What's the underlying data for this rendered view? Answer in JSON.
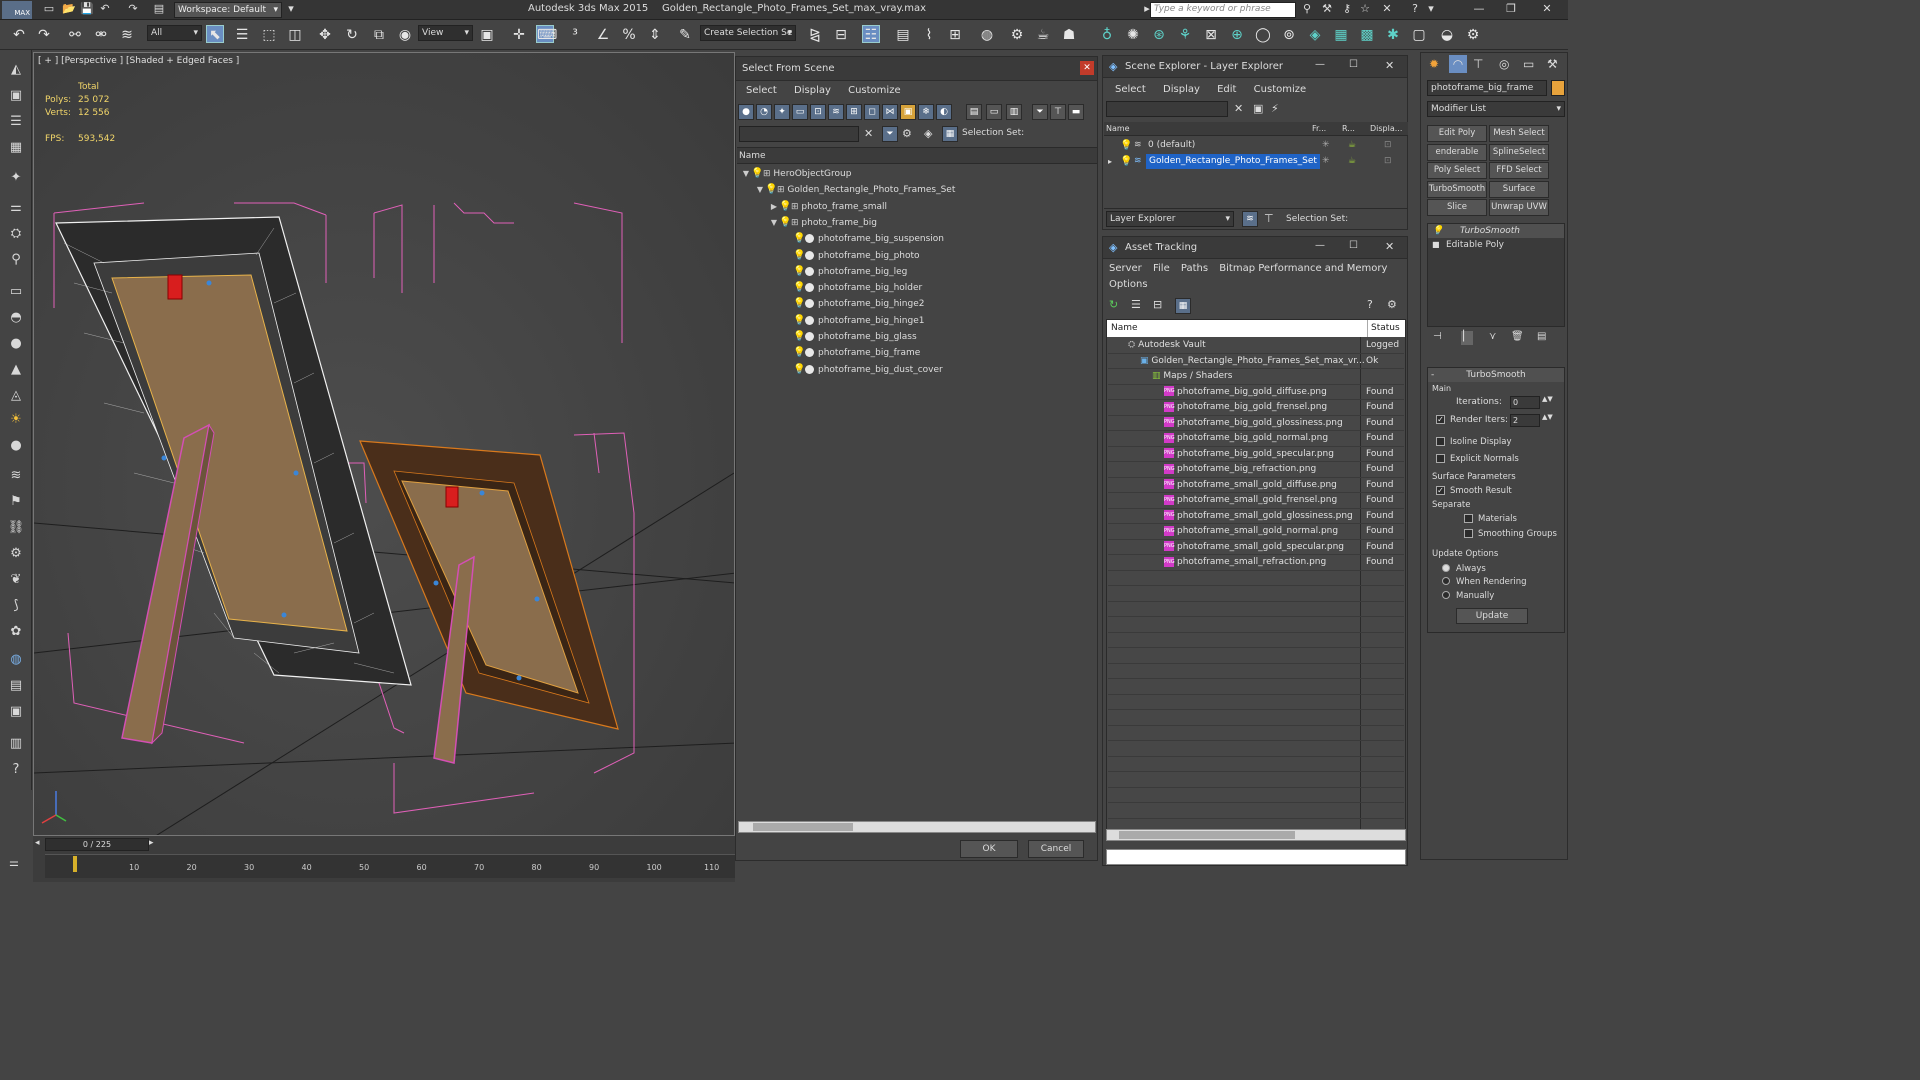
{
  "app": {
    "logo": "MAX",
    "workspace": "Workspace: Default",
    "title_app": "Autodesk 3ds Max  2015",
    "title_file": "Golden_Rectangle_Photo_Frames_Set_max_vray.max",
    "search_placeholder": "Type a keyword or phrase"
  },
  "toolbar": {
    "filter": "All",
    "view": "View",
    "selection_set": "Create Selection Se"
  },
  "viewport": {
    "label": "[ + ] [Perspective ] [Shaded + Edged Faces ]",
    "stats_header": "Total",
    "polys_label": "Polys:",
    "polys_value": "25 072",
    "verts_label": "Verts:",
    "verts_value": "12 556",
    "fps_label": "FPS:",
    "fps_value": "593,542"
  },
  "timeline": {
    "frame": "0 / 225",
    "ticks": [
      "10",
      "20",
      "30",
      "40",
      "50",
      "60",
      "70",
      "80",
      "90",
      "100",
      "110"
    ]
  },
  "select_from_scene": {
    "title": "Select From Scene",
    "menu": [
      "Select",
      "Display",
      "Customize"
    ],
    "selection_set_label": "Selection Set:",
    "column_name": "Name",
    "ok": "OK",
    "cancel": "Cancel",
    "tree": [
      {
        "name": "HeroObjectGroup",
        "level": 0,
        "expand": "down",
        "type": "group"
      },
      {
        "name": "Golden_Rectangle_Photo_Frames_Set",
        "level": 1,
        "expand": "down",
        "type": "group"
      },
      {
        "name": "photo_frame_small",
        "level": 2,
        "expand": "right",
        "type": "group"
      },
      {
        "name": "photo_frame_big",
        "level": 2,
        "expand": "down",
        "type": "group"
      },
      {
        "name": "photoframe_big_suspension",
        "level": 3,
        "expand": "",
        "type": "object"
      },
      {
        "name": "photoframe_big_photo",
        "level": 3,
        "expand": "",
        "type": "object"
      },
      {
        "name": "photoframe_big_leg",
        "level": 3,
        "expand": "",
        "type": "object"
      },
      {
        "name": "photoframe_big_holder",
        "level": 3,
        "expand": "",
        "type": "object"
      },
      {
        "name": "photoframe_big_hinge2",
        "level": 3,
        "expand": "",
        "type": "object"
      },
      {
        "name": "photoframe_big_hinge1",
        "level": 3,
        "expand": "",
        "type": "object"
      },
      {
        "name": "photoframe_big_glass",
        "level": 3,
        "expand": "",
        "type": "object"
      },
      {
        "name": "photoframe_big_frame",
        "level": 3,
        "expand": "",
        "type": "object"
      },
      {
        "name": "photoframe_big_dust_cover",
        "level": 3,
        "expand": "",
        "type": "object"
      }
    ]
  },
  "scene_explorer": {
    "title": "Scene Explorer - Layer Explorer",
    "menu": [
      "Select",
      "Display",
      "Edit",
      "Customize"
    ],
    "columns": [
      "Name",
      "Fr...",
      "R...",
      "Displa..."
    ],
    "layers": [
      {
        "name": "0 (default)",
        "selected": false
      },
      {
        "name": "Golden_Rectangle_Photo_Frames_Set",
        "selected": true
      }
    ],
    "footer_combo": "Layer Explorer",
    "selection_set_label": "Selection Set:"
  },
  "asset_tracking": {
    "title": "Asset Tracking",
    "menu": [
      "Server",
      "File",
      "Paths",
      "Bitmap Performance and Memory"
    ],
    "menu2": "Options",
    "col_name": "Name",
    "col_status": "Status",
    "rows": [
      {
        "name": "Autodesk Vault",
        "status": "Logged",
        "indent": 1,
        "icon": "vault"
      },
      {
        "name": "Golden_Rectangle_Photo_Frames_Set_max_vr...",
        "status": "Ok",
        "indent": 2,
        "icon": "max"
      },
      {
        "name": "Maps / Shaders",
        "status": "",
        "indent": 3,
        "icon": "maps"
      },
      {
        "name": "photoframe_big_gold_diffuse.png",
        "status": "Found",
        "indent": 4,
        "icon": "png"
      },
      {
        "name": "photoframe_big_gold_frensel.png",
        "status": "Found",
        "indent": 4,
        "icon": "png"
      },
      {
        "name": "photoframe_big_gold_glossiness.png",
        "status": "Found",
        "indent": 4,
        "icon": "png"
      },
      {
        "name": "photoframe_big_gold_normal.png",
        "status": "Found",
        "indent": 4,
        "icon": "png"
      },
      {
        "name": "photoframe_big_gold_specular.png",
        "status": "Found",
        "indent": 4,
        "icon": "png"
      },
      {
        "name": "photoframe_big_refraction.png",
        "status": "Found",
        "indent": 4,
        "icon": "png"
      },
      {
        "name": "photoframe_small_gold_diffuse.png",
        "status": "Found",
        "indent": 4,
        "icon": "png"
      },
      {
        "name": "photoframe_small_gold_frensel.png",
        "status": "Found",
        "indent": 4,
        "icon": "png"
      },
      {
        "name": "photoframe_small_gold_glossiness.png",
        "status": "Found",
        "indent": 4,
        "icon": "png"
      },
      {
        "name": "photoframe_small_gold_normal.png",
        "status": "Found",
        "indent": 4,
        "icon": "png"
      },
      {
        "name": "photoframe_small_gold_specular.png",
        "status": "Found",
        "indent": 4,
        "icon": "png"
      },
      {
        "name": "photoframe_small_refraction.png",
        "status": "Found",
        "indent": 4,
        "icon": "png"
      }
    ]
  },
  "command_panel": {
    "object_name": "photoframe_big_frame",
    "object_color": "#e8a33c",
    "modifier_list": "Modifier List",
    "buttons": [
      [
        "Edit Poly",
        "Mesh Select"
      ],
      [
        "enderable Splir",
        "SplineSelect"
      ],
      [
        "Poly Select",
        "FFD Select"
      ],
      [
        "TurboSmooth",
        "Surface Select"
      ],
      [
        "Slice",
        "Unwrap UVW"
      ]
    ],
    "stack": [
      "TurboSmooth",
      "Editable Poly"
    ],
    "rollout_title": "TurboSmooth",
    "main_label": "Main",
    "iterations_label": "Iterations:",
    "iterations_value": "0",
    "render_iters_label": "Render Iters:",
    "render_iters_value": "2",
    "isoline": "Isoline Display",
    "explicit_normals": "Explicit Normals",
    "surface_params": "Surface Parameters",
    "smooth_result": "Smooth Result",
    "separate": "Separate",
    "materials": "Materials",
    "smoothing_groups": "Smoothing Groups",
    "update_options": "Update Options",
    "always": "Always",
    "when_rendering": "When Rendering",
    "manually": "Manually",
    "update": "Update"
  },
  "colors": {
    "selected_blue": "#1f63c6",
    "wire_pink": "#e060b8",
    "frame_orange": "#d9791c"
  }
}
